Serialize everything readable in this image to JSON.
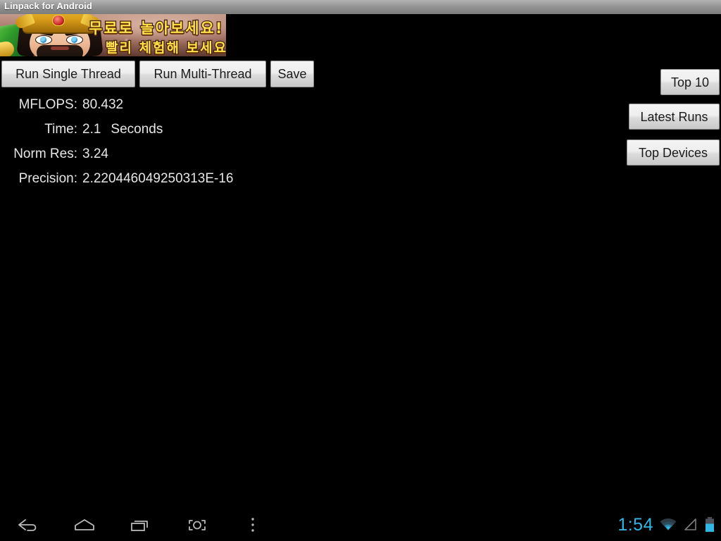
{
  "window": {
    "title": "Linpack for Android"
  },
  "ad_banner": {
    "line1": "무료로 놀아보세요!",
    "line2": "빨리 체험해 보세요",
    "alt": "game-advertisement-warrior-character"
  },
  "action_buttons": [
    {
      "id": "run-single-thread",
      "label": "Run Single Thread"
    },
    {
      "id": "run-multi-thread",
      "label": "Run Multi-Thread"
    },
    {
      "id": "save",
      "label": "Save"
    }
  ],
  "side_buttons": [
    {
      "id": "top-10",
      "label": "Top 10"
    },
    {
      "id": "latest-runs",
      "label": "Latest Runs"
    },
    {
      "id": "top-devices",
      "label": "Top Devices"
    }
  ],
  "results": [
    {
      "label": "MFLOPS:",
      "value": "80.432",
      "unit": ""
    },
    {
      "label": "Time:",
      "value": "2.1",
      "unit": "Seconds"
    },
    {
      "label": "Norm Res:",
      "value": "3.24",
      "unit": ""
    },
    {
      "label": "Precision:",
      "value": "2.220446049250313E-16",
      "unit": ""
    }
  ],
  "navbar": {
    "back": "back-icon",
    "home": "home-icon",
    "recents": "recent-apps-icon",
    "screenshot": "screenshot-icon",
    "menu": "overflow-menu-icon"
  },
  "status": {
    "clock": "1:54",
    "wifi": "wifi-icon",
    "signal": "signal-icon",
    "battery": "battery-icon",
    "clock_color": "#33b5e5"
  }
}
